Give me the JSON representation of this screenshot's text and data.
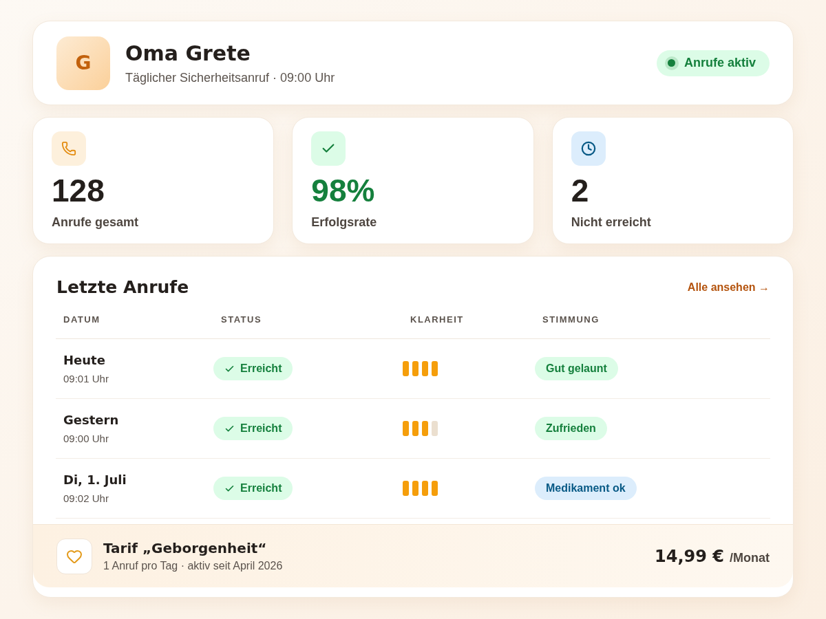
{
  "profile": {
    "initial": "G",
    "name": "Oma Grete",
    "subtitle": "Täglicher Sicherheitsanruf · 09:00 Uhr",
    "status": {
      "label": "Anrufe aktiv",
      "on": true
    }
  },
  "stats": [
    {
      "kind": "calls",
      "value": "128",
      "label": "Anrufe gesamt"
    },
    {
      "kind": "success",
      "value": "98%",
      "label": "Erfolgsrate"
    },
    {
      "kind": "missed",
      "value": "2",
      "label": "Nicht erreicht"
    }
  ],
  "recent_calls": {
    "title": "Letzte Anrufe",
    "link": "Alle ansehen →",
    "columns": [
      "DATUM",
      "STATUS",
      "KLARHEIT",
      "STIMMUNG"
    ],
    "rows": [
      {
        "date": "Heute",
        "time": "09:01 Uhr",
        "status": {
          "kind": "reached",
          "label": "Erreicht"
        },
        "clarity": {
          "level": 1
        },
        "mood": {
          "kind": "positive",
          "label": "Gut gelaunt"
        }
      },
      {
        "date": "Gestern",
        "time": "09:00 Uhr",
        "status": {
          "kind": "reached",
          "label": "Erreicht"
        },
        "clarity": {
          "level": 0.75
        },
        "mood": {
          "kind": "positive",
          "label": "Zufrieden"
        }
      },
      {
        "date": "Di, 1. Juli",
        "time": "09:02 Uhr",
        "status": {
          "kind": "reached",
          "label": "Erreicht"
        },
        "clarity": {
          "level": 1
        },
        "mood": {
          "kind": "medication",
          "label": "Medikament ok"
        }
      }
    ]
  },
  "plan": {
    "name": "Tarif „Geborgenheit“",
    "details": "1 Anruf pro Tag · aktiv seit April 2026",
    "price": "14,99 €",
    "period": "/Monat"
  }
}
